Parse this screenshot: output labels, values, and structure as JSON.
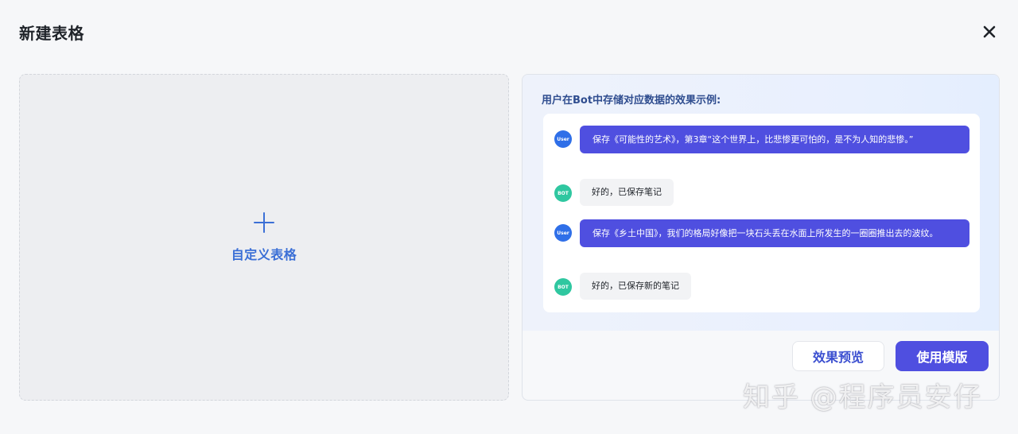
{
  "dialog": {
    "title": "新建表格",
    "close_icon": "close-icon"
  },
  "custom_card": {
    "icon": "plus-icon",
    "label": "自定义表格"
  },
  "template": {
    "heading": "用户在Bot中存储对应数据的效果示例:",
    "messages": [
      {
        "role": "user",
        "avatar": "User",
        "text": "保存《可能性的艺术》，第3章“这个世界上，比悲惨更可怕的，是不为人知的悲惨。”"
      },
      {
        "role": "bot",
        "avatar": "BOT",
        "text": "好的，已保存笔记"
      },
      {
        "role": "user",
        "avatar": "User",
        "text": "保存《乡土中国》，我们的格局好像把一块石头丢在水面上所发生的一圈圈推出去的波纹。"
      },
      {
        "role": "bot",
        "avatar": "BOT",
        "text": "好的，已保存新的笔记"
      }
    ],
    "preview_button": "效果预览",
    "use_button": "使用模版"
  },
  "watermark": "知乎 @程序员安仔",
  "colors": {
    "accent": "#4f4fe0",
    "link_blue": "#3b6fd6",
    "user_avatar": "#2f6fe8",
    "bot_avatar": "#2fc7a0"
  }
}
